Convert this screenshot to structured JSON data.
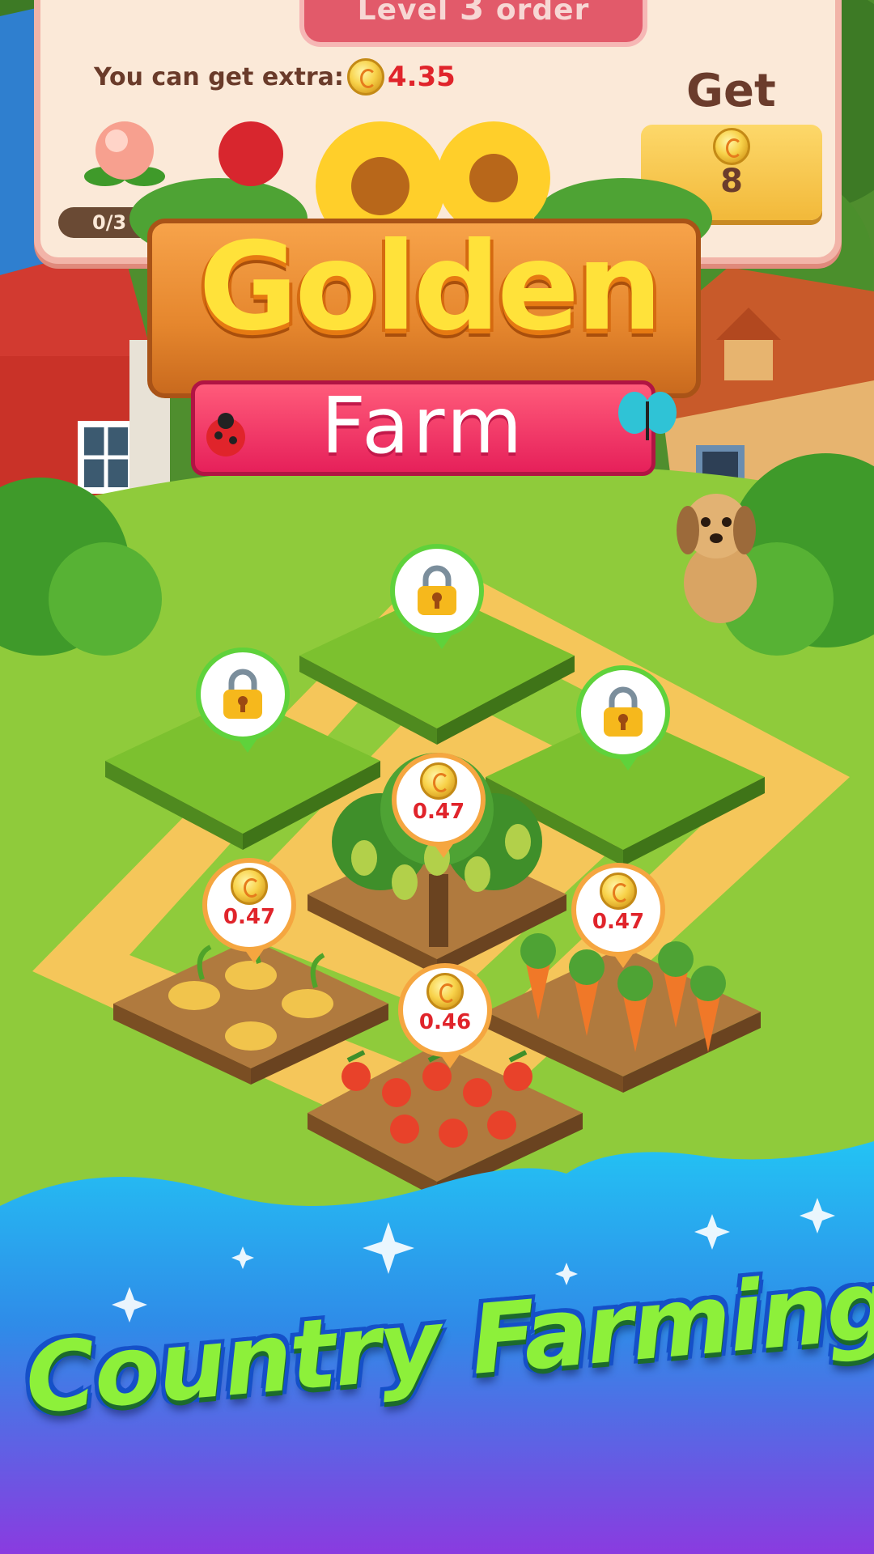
{
  "order": {
    "title_prefix": "Level",
    "level": "3",
    "title_suffix": "order",
    "extra_label": "You can get extra:",
    "extra_value": "4.35",
    "item_icon": "peach-icon",
    "progress": "0/3",
    "get_label": "Get",
    "get_value": "8"
  },
  "logo": {
    "line1": "Golden",
    "line2": "Farm"
  },
  "plots": [
    {
      "type": "locked",
      "icon": "lock-icon"
    },
    {
      "type": "locked",
      "icon": "lock-icon"
    },
    {
      "type": "locked",
      "icon": "lock-icon"
    },
    {
      "type": "crop",
      "crop": "pear-tree",
      "reward": "0.47"
    },
    {
      "type": "crop",
      "crop": "potatoes",
      "reward": "0.47"
    },
    {
      "type": "crop",
      "crop": "carrots",
      "reward": "0.47"
    },
    {
      "type": "crop",
      "crop": "tomatoes",
      "reward": "0.46"
    }
  ],
  "slogan": "Country Farming!",
  "colors": {
    "accent_red": "#e0242b",
    "coin_gold": "#f8d24a",
    "lock_ring_green": "#5fd23b",
    "reward_ring_orange": "#f5a640",
    "water_blue": "#1fb6ef",
    "water_purple": "#8a3be0"
  }
}
